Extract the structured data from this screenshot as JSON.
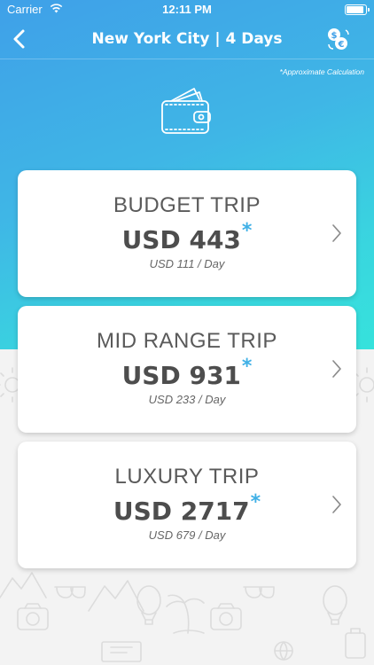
{
  "status_bar": {
    "carrier": "Carrier",
    "time": "12:11 PM"
  },
  "nav": {
    "title": "New York City | 4 Days",
    "back_icon": "chevron-left-icon",
    "currency_icon": "currency-exchange-icon"
  },
  "note": "*Approximate Calculation",
  "trips": [
    {
      "name": "BUDGET TRIP",
      "price": "USD 443",
      "asterisk": "*",
      "per_day": "USD 111 / Day"
    },
    {
      "name": "MID RANGE TRIP",
      "price": "USD 931",
      "asterisk": "*",
      "per_day": "USD 233 / Day"
    },
    {
      "name": "LUXURY TRIP",
      "price": "USD 2717",
      "asterisk": "*",
      "per_day": "USD 679 / Day"
    }
  ],
  "colors": {
    "gradient_top": "#3fa0e8",
    "gradient_bottom": "#36e2dc",
    "accent": "#3fb0e6",
    "text": "#4d4d4d"
  }
}
